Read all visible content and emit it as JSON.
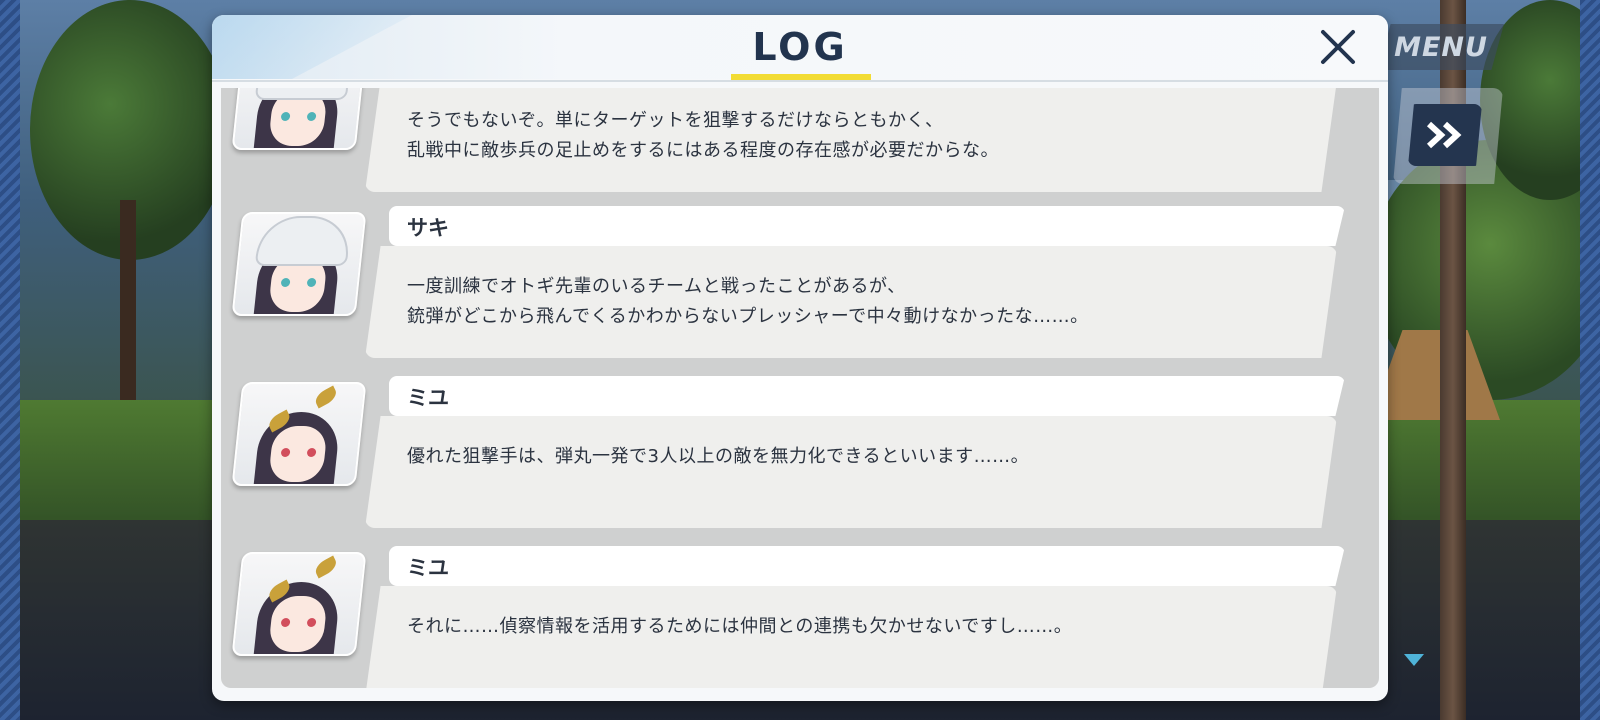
{
  "hud": {
    "menu_label": "MENU"
  },
  "log": {
    "title": "LOG",
    "colors": {
      "accent_underline": "#f2dc34",
      "title_text": "#22344e"
    },
    "entries": [
      {
        "speaker": "",
        "character": "saki",
        "lines": [
          "そうでもないぞ。単にターゲットを狙撃するだけならともかく、",
          "乱戦中に敵歩兵の足止めをするにはある程度の存在感が必要だからな。"
        ]
      },
      {
        "speaker": "サキ",
        "character": "saki",
        "lines": [
          "一度訓練でオトギ先輩のいるチームと戦ったことがあるが、",
          "銃弾がどこから飛んでくるかわからないプレッシャーで中々動けなかったな……。"
        ]
      },
      {
        "speaker": "ミユ",
        "character": "miyu",
        "lines": [
          "優れた狙撃手は、弾丸一発で3人以上の敵を無力化できるといいます……。",
          ""
        ]
      },
      {
        "speaker": "ミユ",
        "character": "miyu",
        "lines": [
          "それに……偵察情報を活用するためには仲間との連携も欠かせないですし……。",
          ""
        ]
      }
    ]
  }
}
